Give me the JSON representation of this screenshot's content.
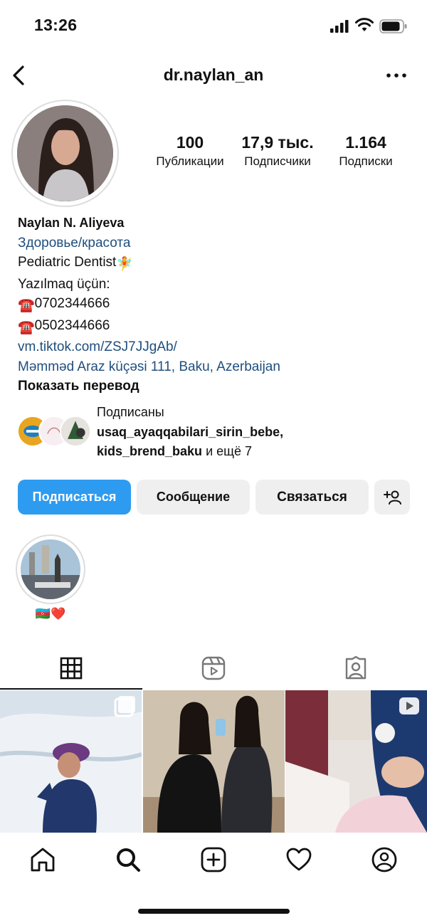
{
  "status_bar": {
    "time": "13:26"
  },
  "header": {
    "username": "dr.naylan_an"
  },
  "profile": {
    "stats": [
      {
        "value": "100",
        "label": "Публикации"
      },
      {
        "value": "17,9 тыс.",
        "label": "Подписчики"
      },
      {
        "value": "1.164",
        "label": "Подписки"
      }
    ],
    "name": "Naylan N. Aliyeva",
    "category": "Здоровье/красота",
    "bio_line1": "Pediatric Dentist",
    "bio_line2": "Yazılmaq üçün:",
    "phone1": "0702344666",
    "phone2": "0502344666",
    "link": "vm.tiktok.com/ZSJ7JJgAb/",
    "address": "Məmməd Araz küçəsi 111, Baku, Azerbaijan",
    "translate": "Показать перевод"
  },
  "followed_by": {
    "prefix": "Подписаны",
    "account1": "usaq_ayaqqabilari_sirin_bebe,",
    "account2": "kids_brend_baku",
    "suffix": " и ещё 7"
  },
  "actions": {
    "follow": "Подписаться",
    "message": "Сообщение",
    "contact": "Связаться"
  },
  "highlights": [
    {
      "label": "🇦🇿❤️"
    }
  ],
  "tabs": [
    "grid-icon",
    "reels-icon",
    "tagged-icon"
  ],
  "bottom_nav": [
    "home-icon",
    "search-icon",
    "create-icon",
    "activity-icon",
    "profile-icon"
  ],
  "colors": {
    "accent": "#2d9bf0",
    "link": "#1f4e7d"
  }
}
